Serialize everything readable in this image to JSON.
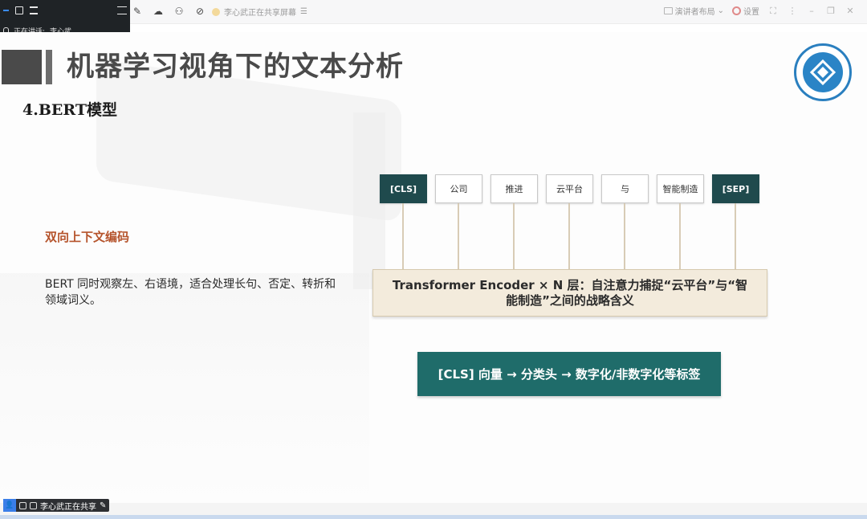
{
  "toolbar": {
    "share_status": "李心武正在共享屏幕",
    "presenter_layout": "演讲者布局",
    "settings": "设置"
  },
  "speaker_panel": {
    "speaking_label": "正在讲话:",
    "speaker_name": "李心武"
  },
  "slide": {
    "title": "机器学习视角下的文本分析",
    "section": "4.BERT模型",
    "subheading": "双向上下文编码",
    "body": "BERT 同时观察左、右语境，适合处理长句、否定、转折和领域词义。",
    "tokens": [
      "[CLS]",
      "公司",
      "推进",
      "云平台",
      "与",
      "智能制造",
      "[SEP]"
    ],
    "encoder_text": "Transformer Encoder × N 层：自注意力捕捉“云平台”与“智能制造”之间的战略含义",
    "output_text": "[CLS] 向量 → 分类头 → 数字化/非数字化等标签"
  },
  "bottom": {
    "sharing_label": "李心武正在共享"
  },
  "colors": {
    "dark_teal": "#1f4a4d",
    "output_teal": "#1f6c6a",
    "accent_orange": "#b5532b",
    "encoder_bg": "#f3ebdc"
  }
}
